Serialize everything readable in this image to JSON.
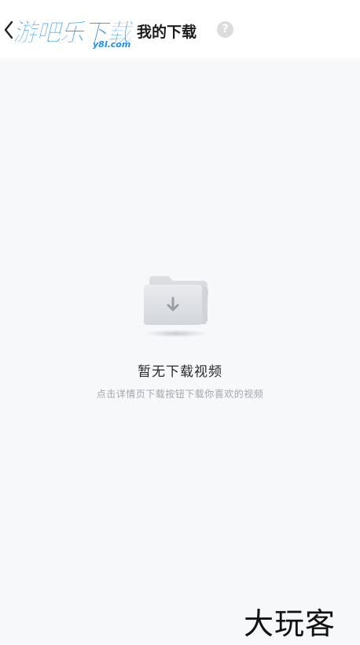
{
  "header": {
    "title": "我的下载",
    "help_symbol": "?",
    "back_icon": "chevron-left-icon"
  },
  "watermark": {
    "logo_text": "游吧乐下载",
    "logo_sub": "y8l.com",
    "corner_text": "大玩客"
  },
  "empty_state": {
    "icon": "folder-download-icon",
    "title": "暂无下载视频",
    "hint": "点击详情页下载按钮下载你喜欢的视频"
  },
  "colors": {
    "background": "#f7f8fa",
    "header_bg": "#ffffff",
    "title_text": "#1c1c1e",
    "hint_text": "#a3a6ad",
    "help_badge": "#dcdcdf",
    "logo_blue": "#1b8fe8"
  }
}
